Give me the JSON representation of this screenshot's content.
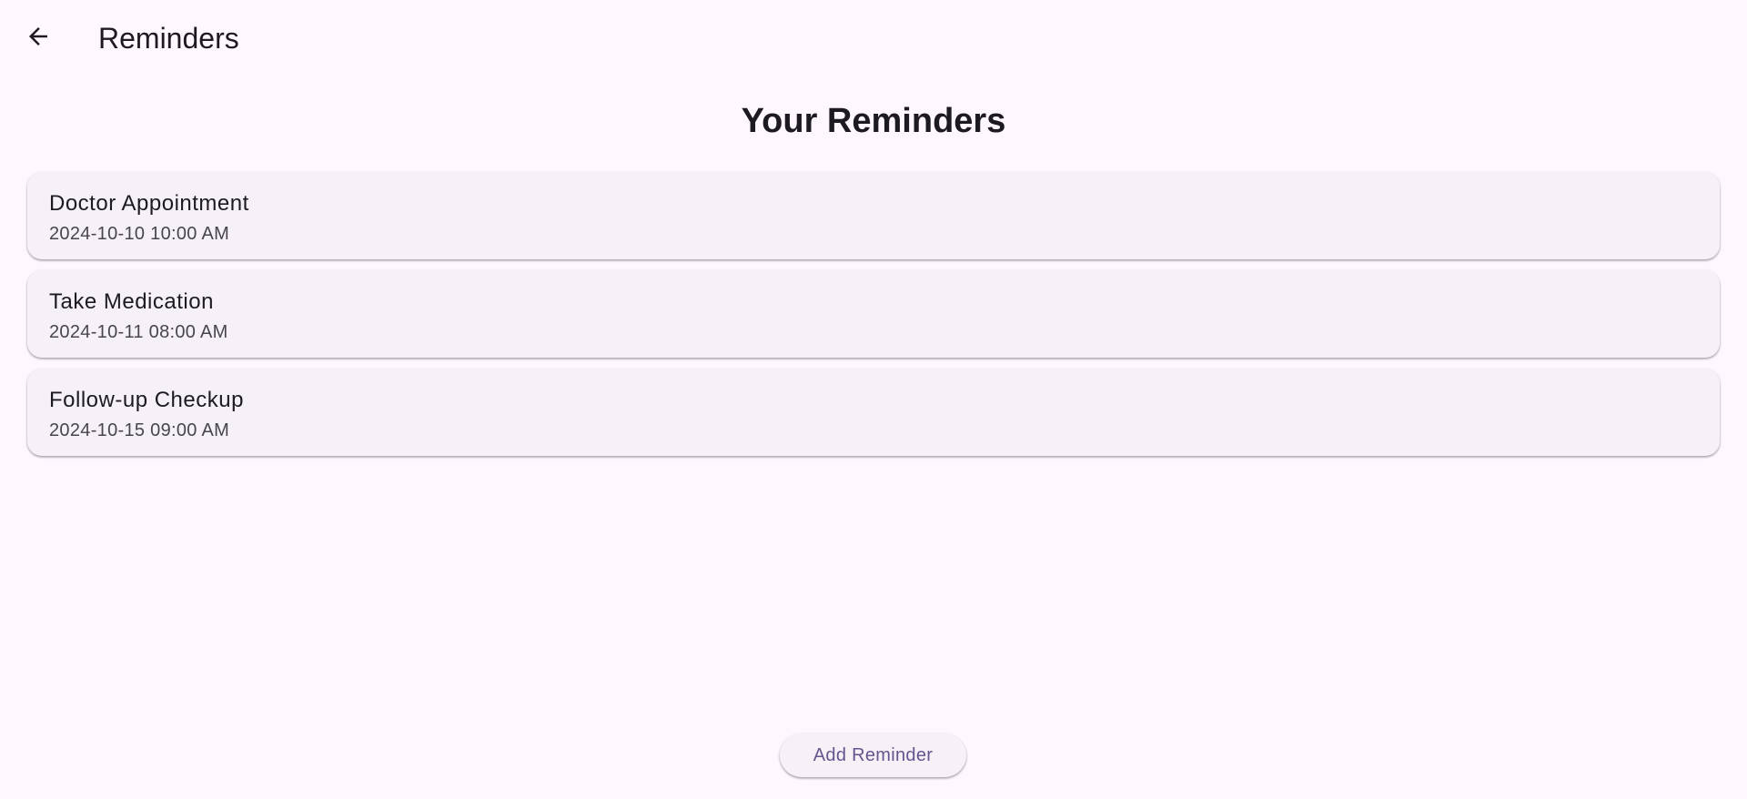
{
  "app_bar": {
    "back_icon": "arrow-left-icon",
    "title": "Reminders"
  },
  "main": {
    "heading": "Your Reminders",
    "reminders": [
      {
        "title": "Doctor Appointment",
        "datetime": "2024-10-10 10:00 AM"
      },
      {
        "title": "Take Medication",
        "datetime": "2024-10-11 08:00 AM"
      },
      {
        "title": "Follow-up Checkup",
        "datetime": "2024-10-15 09:00 AM"
      }
    ]
  },
  "footer": {
    "add_label": "Add Reminder"
  },
  "colors": {
    "background": "#fef7ff",
    "card": "#f6f1f7",
    "accent": "#65558f",
    "text_primary": "#1d1b20",
    "text_secondary": "#49454f"
  }
}
